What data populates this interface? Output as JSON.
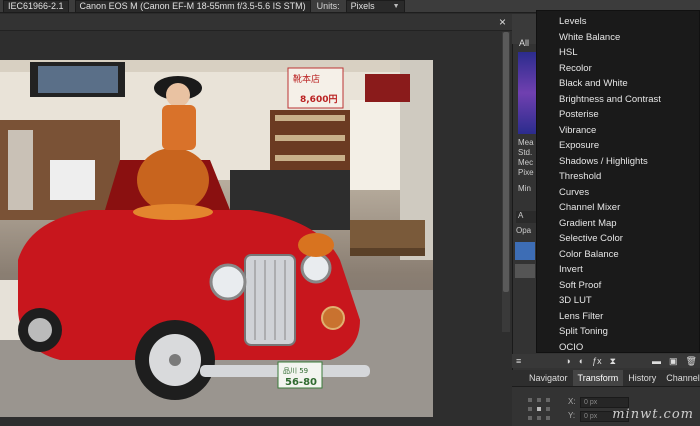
{
  "toolbar": {
    "color_profile": "IEC61966-2.1",
    "camera": "Canon EOS M (Canon EF-M 18-55mm f/3.5-5.6 IS STM)",
    "units_label": "Units:",
    "units_value": "Pixels"
  },
  "document": {
    "close_glyph": "×"
  },
  "right_panel": {
    "tab_all": "All",
    "meta_lines": [
      "Mea",
      "Std.",
      "Mec",
      "Pixe"
    ],
    "min_label": "Min",
    "a_label": "A",
    "opacity_label": "Opa"
  },
  "adjustments_menu": {
    "items": [
      "Levels",
      "White Balance",
      "HSL",
      "Recolor",
      "Black and White",
      "Brightness and Contrast",
      "Posterise",
      "Vibrance",
      "Exposure",
      "Shadows / Highlights",
      "Threshold",
      "Curves",
      "Channel Mixer",
      "Gradient Map",
      "Selective Color",
      "Color Balance",
      "Invert",
      "Soft Proof",
      "3D LUT",
      "Lens Filter",
      "Split Toning",
      "OCIO"
    ]
  },
  "bottom_tabs": [
    "Navigator",
    "Transform",
    "History",
    "Channels"
  ],
  "transform": {
    "x_label": "X:",
    "y_label": "Y:",
    "x_value": "0 px",
    "y_value": "0 px"
  },
  "watermark": "minwt.com",
  "photo_signs": {
    "sign1": "靴本店",
    "sign1_price": "8,600円",
    "plate_top": "品川 59",
    "plate_num": "56-80"
  }
}
